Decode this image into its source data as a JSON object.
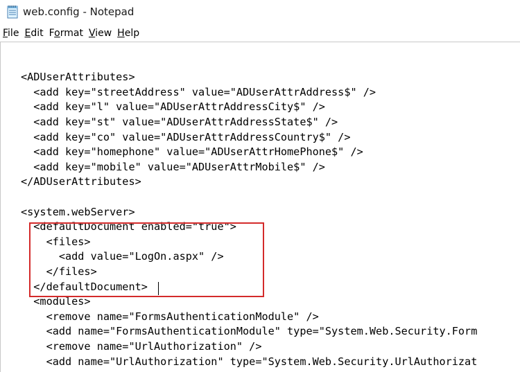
{
  "window": {
    "title": "web.config - Notepad",
    "icon": "notepad-icon"
  },
  "menu": {
    "items": [
      {
        "label": "File",
        "hotkey": "F",
        "rest": "ile"
      },
      {
        "label": "Edit",
        "hotkey": "E",
        "rest": "dit"
      },
      {
        "label": "Format",
        "hotkey": "o",
        "pre": "F",
        "rest": "rmat"
      },
      {
        "label": "View",
        "hotkey": "V",
        "rest": "iew"
      },
      {
        "label": "Help",
        "hotkey": "H",
        "rest": "elp"
      }
    ]
  },
  "editor": {
    "lines": [
      "<ADUserAttributes>",
      "  <add key=\"streetAddress\" value=\"ADUserAttrAddress$\" />",
      "  <add key=\"l\" value=\"ADUserAttrAddressCity$\" />",
      "  <add key=\"st\" value=\"ADUserAttrAddressState$\" />",
      "  <add key=\"co\" value=\"ADUserAttrAddressCountry$\" />",
      "  <add key=\"homephone\" value=\"ADUserAttrHomePhone$\" />",
      "  <add key=\"mobile\" value=\"ADUserAttrMobile$\" />",
      "</ADUserAttributes>",
      "",
      "<system.webServer>",
      "  <defaultDocument enabled=\"true\">",
      "    <files>",
      "      <add value=\"LogOn.aspx\" />",
      "    </files>",
      "  </defaultDocument>",
      "  <modules>",
      "    <remove name=\"FormsAuthenticationModule\" />",
      "    <add name=\"FormsAuthenticationModule\" type=\"System.Web.Security.Form",
      "    <remove name=\"UrlAuthorization\" />",
      "    <add name=\"UrlAuthorization\" type=\"System.Web.Security.UrlAuthorizat"
    ],
    "highlight_color": "#d42a2a"
  }
}
